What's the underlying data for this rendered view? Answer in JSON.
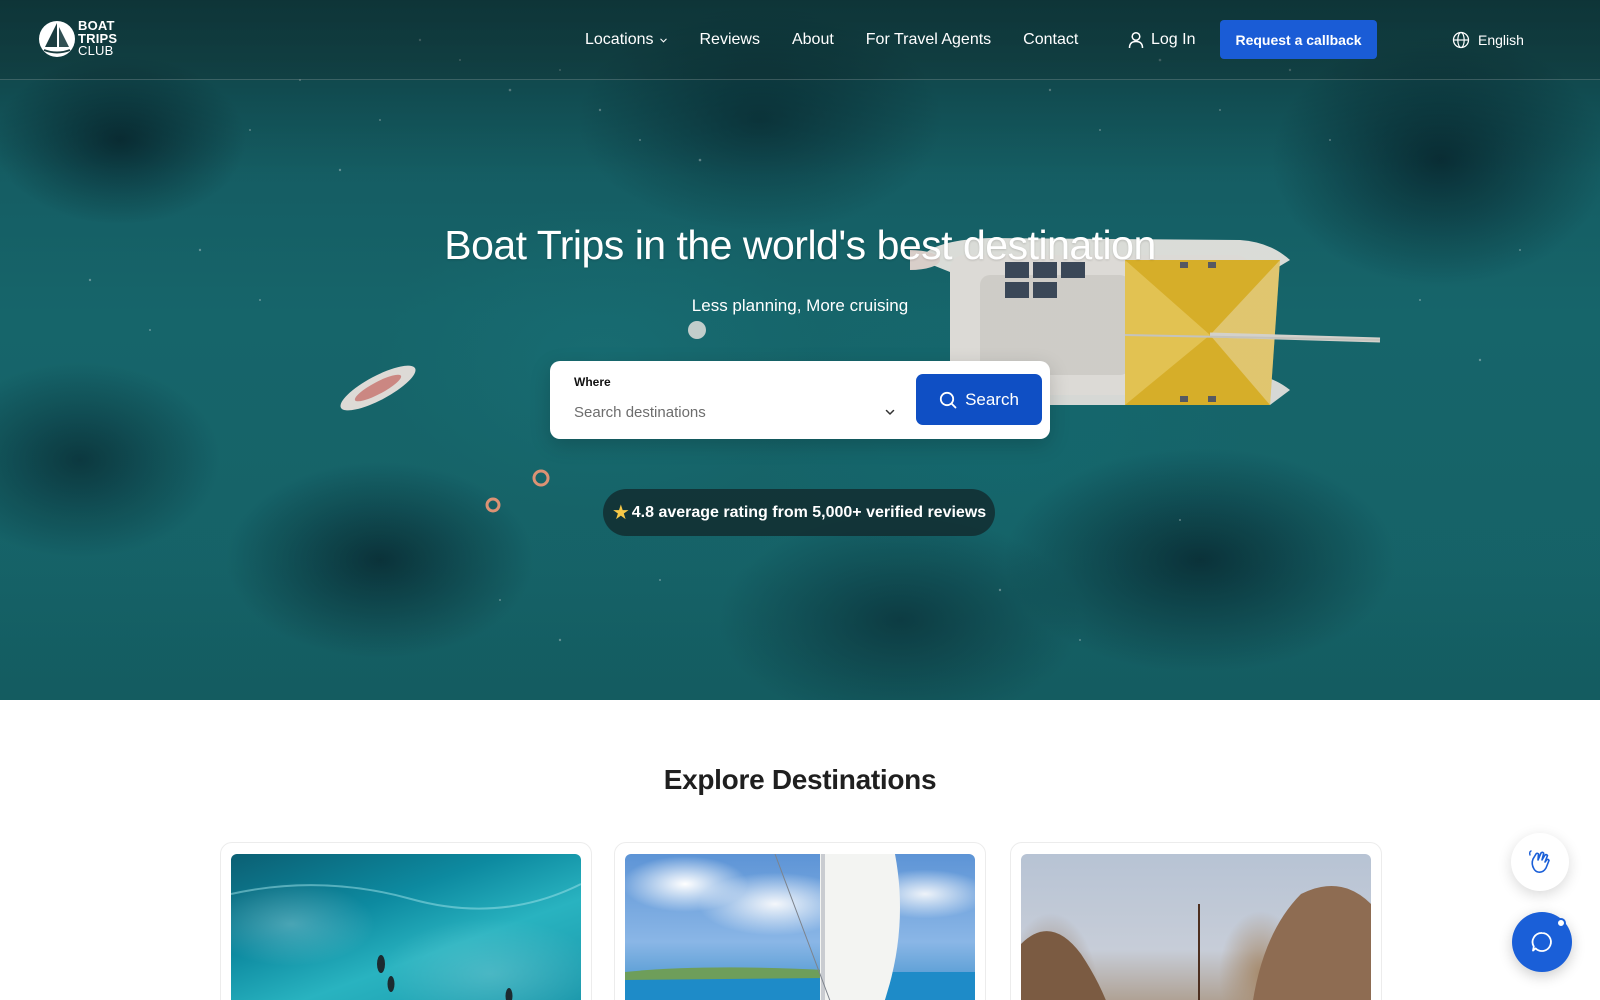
{
  "brand": {
    "line1": "BOAT",
    "line2": "TRIPS",
    "line3": "CLUB"
  },
  "nav": {
    "items": [
      {
        "label": "Locations",
        "has_dropdown": true
      },
      {
        "label": "Reviews"
      },
      {
        "label": "About"
      },
      {
        "label": "For Travel Agents"
      },
      {
        "label": "Contact"
      }
    ],
    "login_label": "Log In",
    "callback_label": "Request a callback",
    "language_label": "English"
  },
  "hero": {
    "title": "Boat Trips in the world's best destination",
    "subtitle": "Less planning, More cruising",
    "search": {
      "label": "Where",
      "placeholder": "Search destinations",
      "button_label": "Search"
    },
    "rating_text": "4.8 average rating from 5,000+ verified reviews",
    "rating_icon": "star-icon"
  },
  "explore": {
    "title": "Explore Destinations",
    "cards": [
      {
        "image": "ocean-paddleboard-image"
      },
      {
        "image": "sailboat-coast-image"
      },
      {
        "image": "rock-arch-image"
      }
    ]
  },
  "floating": {
    "wave_icon": "waving-hand-icon",
    "chat_icon": "chat-bubble-icon"
  },
  "colors": {
    "primary_button": "#1a5cd6",
    "search_button": "#0f4fc4",
    "star": "#f7c948",
    "text_dark": "#1f1f1f"
  }
}
